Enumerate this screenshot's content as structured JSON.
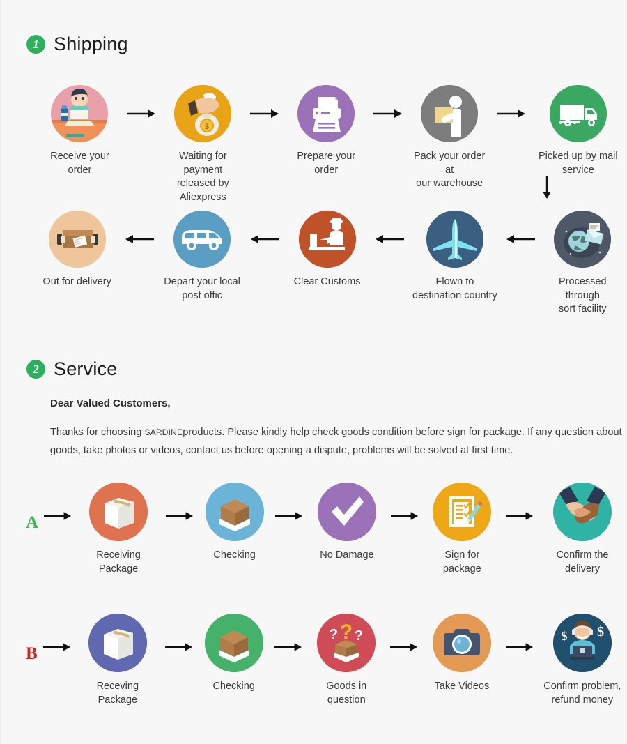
{
  "page": {
    "background": "#f7f7f7"
  },
  "sections": [
    {
      "badge": "1",
      "badge_color": "#2cb05e",
      "title": "Shipping"
    },
    {
      "badge": "2",
      "badge_color": "#2cb05e",
      "title": "Service"
    }
  ],
  "shipping": {
    "row1": [
      {
        "icon": "person-at-laptop-icon",
        "label": "Receive your order",
        "color": "#e8a0ab"
      },
      {
        "icon": "hand-holding-money-bag-icon",
        "label": "Waiting for payment\nreleased by Aliexpress",
        "color": "#e8a317"
      },
      {
        "icon": "printer-icon",
        "label": "Prepare your order",
        "color": "#9b72b8"
      },
      {
        "icon": "worker-packing-box-icon",
        "label": "Pack your order at\nour warehouse",
        "color": "#7d7d7d"
      },
      {
        "icon": "delivery-truck-icon",
        "label": "Picked up by mail service",
        "color": "#3aa863"
      }
    ],
    "row2": [
      {
        "icon": "open-crate-package-icon",
        "label": "Out for delivery",
        "color": "#efc69b"
      },
      {
        "icon": "delivery-van-icon",
        "label": "Depart your local\npost offic",
        "color": "#5a9ec4"
      },
      {
        "icon": "customs-officer-icon",
        "label": "Clear  Customs",
        "color": "#c0522a"
      },
      {
        "icon": "airplane-icon",
        "label": "Flown to\ndestination country",
        "color": "#3b5f80"
      },
      {
        "icon": "globe-mail-sorting-icon",
        "label": "Processed through\nsort facility",
        "color": "#4e5866"
      }
    ],
    "vertical_arrow": "down-arrow-icon"
  },
  "service": {
    "greeting": "Dear Valued Customers,",
    "body_line1_pre": "Thanks for choosing ",
    "body_brand": "SARDINE",
    "body_line1_post": "products. Please kindly help check goods condition before sign for package. If any question",
    "body_line2": "about goods, take photos or videos, contact us before opening a dispute, problems will be solved at first time.",
    "rows": [
      {
        "letter": "A",
        "letter_color": "#3cb54a",
        "steps": [
          {
            "icon": "sealed-box-icon",
            "label": "Receiving Package",
            "color": "#e0734f"
          },
          {
            "icon": "open-box-icon",
            "label": "Checking",
            "color": "#6cb3d8"
          },
          {
            "icon": "checkmark-icon",
            "label": "No Damage",
            "color": "#9b72b8"
          },
          {
            "icon": "signed-document-icon",
            "label": "Sign for package",
            "color": "#eea716"
          },
          {
            "icon": "handshake-icon",
            "label": "Confirm the delivery",
            "color": "#2fb3a4"
          }
        ]
      },
      {
        "letter": "B",
        "letter_color": "#d61f1f",
        "steps": [
          {
            "icon": "sealed-box-icon",
            "label": "Receving Package",
            "color": "#6068b0"
          },
          {
            "icon": "open-box-icon",
            "label": "Checking",
            "color": "#45b16a"
          },
          {
            "icon": "question-box-icon",
            "label": "Goods in question",
            "color": "#cf4b55"
          },
          {
            "icon": "camera-icon",
            "label": "Take Videos",
            "color": "#e49a55"
          },
          {
            "icon": "support-agent-icon",
            "label": "Confirm problem,\nrefund money",
            "color": "#21506f"
          }
        ]
      }
    ]
  }
}
